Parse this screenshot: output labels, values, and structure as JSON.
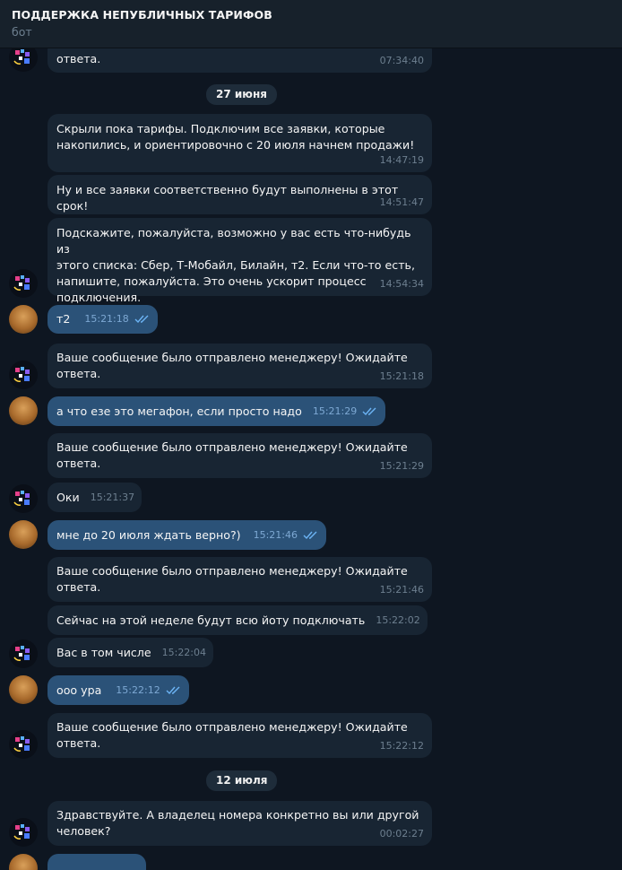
{
  "header": {
    "title": "ПОДДЕРЖКА НЕПУБЛИЧНЫХ ТАРИФОВ",
    "subtitle": "бот"
  },
  "messages": [
    {
      "text": "ответа.",
      "time": "07:34:40"
    },
    {
      "date": "27 июня"
    },
    {
      "text": "Скрыли пока тарифы. Подключим все заявки, которые\nнакопились, и ориентировочно с 20 июля начнем продажи!",
      "time": "14:47:19"
    },
    {
      "text": "Ну и все заявки соответственно будут выполнены в этот срок!",
      "time": "14:51:47"
    },
    {
      "text": "Подскажите, пожалуйста, возможно у вас есть что-нибудь из\nэтого списка: Сбер, Т-Мобайл, Билайн, т2. Если что-то есть,\nнапишите, пожалуйста. Это очень ускорит процесс\nподключения.",
      "time": "14:54:34"
    },
    {
      "text": "т2",
      "time": "15:21:18"
    },
    {
      "text": "Ваше сообщение было отправлено менеджеру! Ожидайте\nответа.",
      "time": "15:21:18"
    },
    {
      "text": "а что езе это мегафон, если просто надо",
      "time": "15:21:29"
    },
    {
      "text": "Ваше сообщение было отправлено менеджеру! Ожидайте\nответа.",
      "time": "15:21:29"
    },
    {
      "text": "Оки",
      "time": "15:21:37"
    },
    {
      "text": "мне до 20 июля ждать верно?)",
      "time": "15:21:46"
    },
    {
      "text": "Ваше сообщение было отправлено менеджеру! Ожидайте\nответа.",
      "time": "15:21:46"
    },
    {
      "text": "Сейчас на этой неделе будут всю йоту подключать",
      "time": "15:22:02"
    },
    {
      "text": "Вас в том числе",
      "time": "15:22:04"
    },
    {
      "text": "ооо ура",
      "time": "15:22:12"
    },
    {
      "text": "Ваше сообщение было отправлено менеджеру! Ожидайте\nответа.",
      "time": "15:22:12"
    },
    {
      "date": "12 июля"
    },
    {
      "text": "Здравствуйте. А владелец номера конкретно вы или другой\nчеловек?",
      "time": "00:02:27"
    }
  ]
}
